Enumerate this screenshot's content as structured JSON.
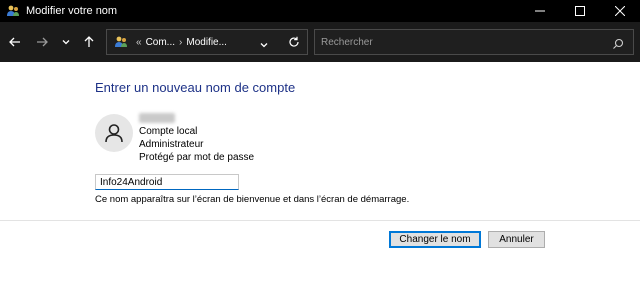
{
  "window": {
    "title": "Modifier votre nom",
    "controls": [
      "minimize",
      "maximize",
      "close"
    ]
  },
  "navbar": {
    "back_icon": "arrow-left-icon",
    "forward_icon": "arrow-right-icon",
    "recent_icon": "chevron-down-icon",
    "up_icon": "arrow-up-icon",
    "address": {
      "overflow": "«",
      "crumbs": [
        "Com...",
        "Modifie..."
      ],
      "separator": "›"
    },
    "search": {
      "placeholder": "Rechercher"
    }
  },
  "content": {
    "heading": "Entrer un nouveau nom de compte",
    "account": {
      "lines": [
        "Compte local",
        "Administrateur",
        "Protégé par mot de passe"
      ]
    },
    "name_field": {
      "value": "Info24Android"
    },
    "hint": "Ce nom apparaîtra sur l’écran de bienvenue et dans l’écran de démarrage."
  },
  "buttons": {
    "change": "Changer le nom",
    "cancel": "Annuler"
  },
  "colors": {
    "heading": "#1e3287",
    "accent": "#0078d7",
    "titlebar": "#000000",
    "navbar": "#1b1b1b"
  }
}
